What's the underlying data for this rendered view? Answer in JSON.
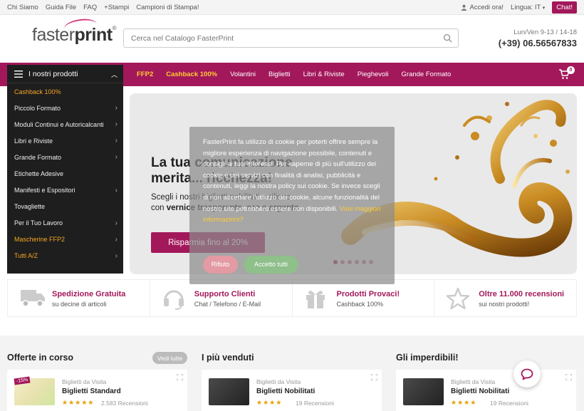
{
  "topbar": {
    "links": [
      "Chi Siamo",
      "Guida File",
      "FAQ",
      "+Stampi",
      "Campioni di Stampa!"
    ],
    "account": "Accedi ora!",
    "language": "Lingua: IT",
    "chat": "Chat!"
  },
  "header": {
    "logo_light": "faster",
    "logo_bold": "print",
    "search_placeholder": "Cerca nel Catalogo FasterPrint",
    "hours": "Lun/Ven 9-13 / 14-18",
    "phone": "(+39) 06.56567833"
  },
  "nav": {
    "menu_label": "I nostri prodotti",
    "items": [
      "FFP2",
      "Cashback 100%",
      "Volantini",
      "Biglietti",
      "Libri & Riviste",
      "Pieghevoli",
      "Grande Formato"
    ],
    "cart_count": "0"
  },
  "sidebar": {
    "items": [
      {
        "label": "Cashback 100%",
        "highlight": true,
        "arrow": false
      },
      {
        "label": "Piccolo Formato",
        "highlight": false,
        "arrow": true
      },
      {
        "label": "Moduli Continui e Autoricalcanti",
        "highlight": false,
        "arrow": true
      },
      {
        "label": "Libri e Riviste",
        "highlight": false,
        "arrow": true
      },
      {
        "label": "Grande Formato",
        "highlight": false,
        "arrow": true
      },
      {
        "label": "Etichette Adesive",
        "highlight": false,
        "arrow": false
      },
      {
        "label": "Manifesti e Espositori",
        "highlight": false,
        "arrow": true
      },
      {
        "label": "Tovagliette",
        "highlight": false,
        "arrow": false
      },
      {
        "label": "Per il Tuo Lavoro",
        "highlight": false,
        "arrow": true
      },
      {
        "label": "Mascherine FFP2",
        "highlight": true,
        "arrow": true
      },
      {
        "label": "Tutti A/Z",
        "highlight": true,
        "arrow": true
      }
    ]
  },
  "hero": {
    "title": "La tua comunicazione merita... ricchezza!",
    "sub_line1": "Scegli i nostri biglietti nobilitati a rilievo",
    "sub_prefix": "con ",
    "sub_bold": "vernice trasparente, oro e argento",
    "button": "Risparmia fino al 20%"
  },
  "cookie": {
    "text": "FasterPrint fa utilizzo di cookie per poterti offrire sempre la migliore esperienza di navigazione possibile, contenuti e consigli ai tuoi interessi. Per saperne di più sull'utilizzo dei cookie e dei servizi con finalità di analisi, pubblicità e contenuti, leggi la nostra policy sui cookie. Se invece scegli di non accettare l'utilizzo dei cookie, alcune funzionalità del nostro sito potrebbero essere non disponibili.",
    "link": "Vuoi maggiori informazioni?",
    "reject": "Rifiuto",
    "accept": "Accetto tutti"
  },
  "features": [
    {
      "title": "Spedizione Gratuita",
      "sub": "su decine di articoli",
      "icon": "truck-icon"
    },
    {
      "title": "Supporto Clienti",
      "sub": "Chat / Telefono / E-Mail",
      "icon": "headset-icon"
    },
    {
      "title": "Prodotti Provaci!",
      "sub": "Cashback 100%",
      "icon": "gift-icon"
    },
    {
      "title": "Oltre 11.000 recensioni",
      "sub": "sui nostri prodotti!",
      "icon": "star-icon"
    }
  ],
  "sections": {
    "offers": "Offerte in corso",
    "see_all": "Vedi tutte",
    "bestsellers": "I più venduti",
    "unmissable": "Gli imperdibili!"
  },
  "cards": [
    {
      "category": "Biglietti da Visita",
      "name": "Biglietti Standard",
      "stars": "★★★★★",
      "reviews": "2.583 Recensioni",
      "badge": "-15%"
    },
    {
      "category": "Biglietti da Visita",
      "name": "Biglietti Nobilitati",
      "stars": "★★★★",
      "reviews": "19 Recensioni"
    },
    {
      "category": "Biglietti da Visita",
      "name": "Biglietti Nobilitati",
      "stars": "★★★★",
      "reviews": "19 Recensioni"
    }
  ],
  "colors": {
    "brand": "#a3185b",
    "accent": "#ffcc33",
    "sidebar_bg": "#1e1e1e"
  }
}
